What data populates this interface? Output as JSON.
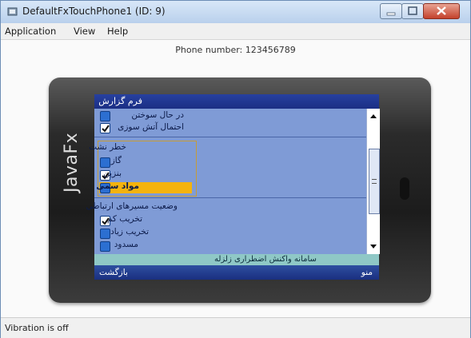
{
  "window": {
    "title": "DefaultFxTouchPhone1 (ID: 9)"
  },
  "menubar": {
    "items": [
      "Application",
      "View",
      "Help"
    ]
  },
  "client": {
    "phone_label": "Phone number: 123456789"
  },
  "status": {
    "text": "Vibration is off"
  },
  "phone": {
    "brand": "JavaFx",
    "screen": {
      "title": "فرم گزارش",
      "items": [
        {
          "label": "در حال سوختن",
          "checked": false
        },
        {
          "label": "احتمال آتش سوزی",
          "checked": true
        }
      ],
      "group1": {
        "heading": "خطر نشت",
        "items": [
          {
            "label": "گاز",
            "checked": false
          },
          {
            "label": "بنزین",
            "checked": true
          },
          {
            "label": "مواد سمی",
            "checked": false,
            "selected": true
          }
        ]
      },
      "group2": {
        "heading": "وضعیت مسیرهای ارتباطی",
        "items": [
          {
            "label": "تخریب کم",
            "checked": true
          },
          {
            "label": "تخریب زیاد",
            "checked": false
          },
          {
            "label": "مسدود",
            "checked": false
          }
        ]
      },
      "ticker": "سامانه واکنش اضطراری زلزله",
      "softkey_left": "بازگشت",
      "softkey_right": "منو"
    }
  },
  "colors": {
    "screen_bg": "#7f9bd6",
    "highlight": "#f4b30d",
    "ticker_bg": "#8fc8c6",
    "titlebar": "#1b2f84"
  }
}
